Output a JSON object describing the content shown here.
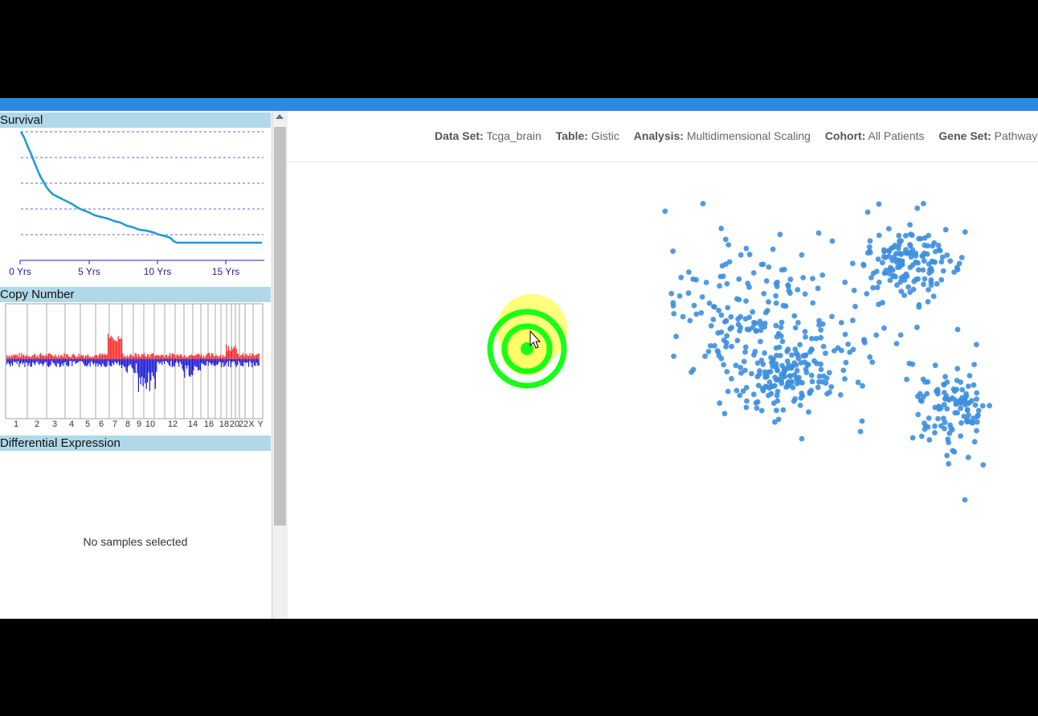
{
  "panels": {
    "survival": {
      "title": "Survival",
      "x_ticks": [
        "0 Yrs",
        "5 Yrs",
        "10 Yrs",
        "15 Yrs"
      ]
    },
    "copy_number": {
      "title": "Copy Number",
      "chromosomes": [
        "1",
        "2",
        "3",
        "4",
        "5",
        "6",
        "7",
        "8",
        "9",
        "10",
        "12",
        "14",
        "16",
        "18",
        "20",
        "22",
        "X",
        "Y"
      ]
    },
    "differential_expression": {
      "title": "Differential Expression",
      "empty_message": "No samples selected"
    }
  },
  "infobar": [
    {
      "label": "Data Set:",
      "value": "Tcga_brain"
    },
    {
      "label": "Table:",
      "value": "Gistic"
    },
    {
      "label": "Analysis:",
      "value": "Multidimensional Scaling"
    },
    {
      "label": "Cohort:",
      "value": "All Patients"
    },
    {
      "label": "Gene Set:",
      "value": "Pathways I"
    }
  ],
  "colors": {
    "topbar": "#2a8ae0",
    "panel_header": "#b0d8e8",
    "point": "#3d8fde",
    "gain": "#ff2a2a",
    "loss": "#1a1ad8",
    "survival_line": "#1a9ad8",
    "cursor_ring": "#17ff17",
    "cursor_glow": "#ffff55"
  }
}
